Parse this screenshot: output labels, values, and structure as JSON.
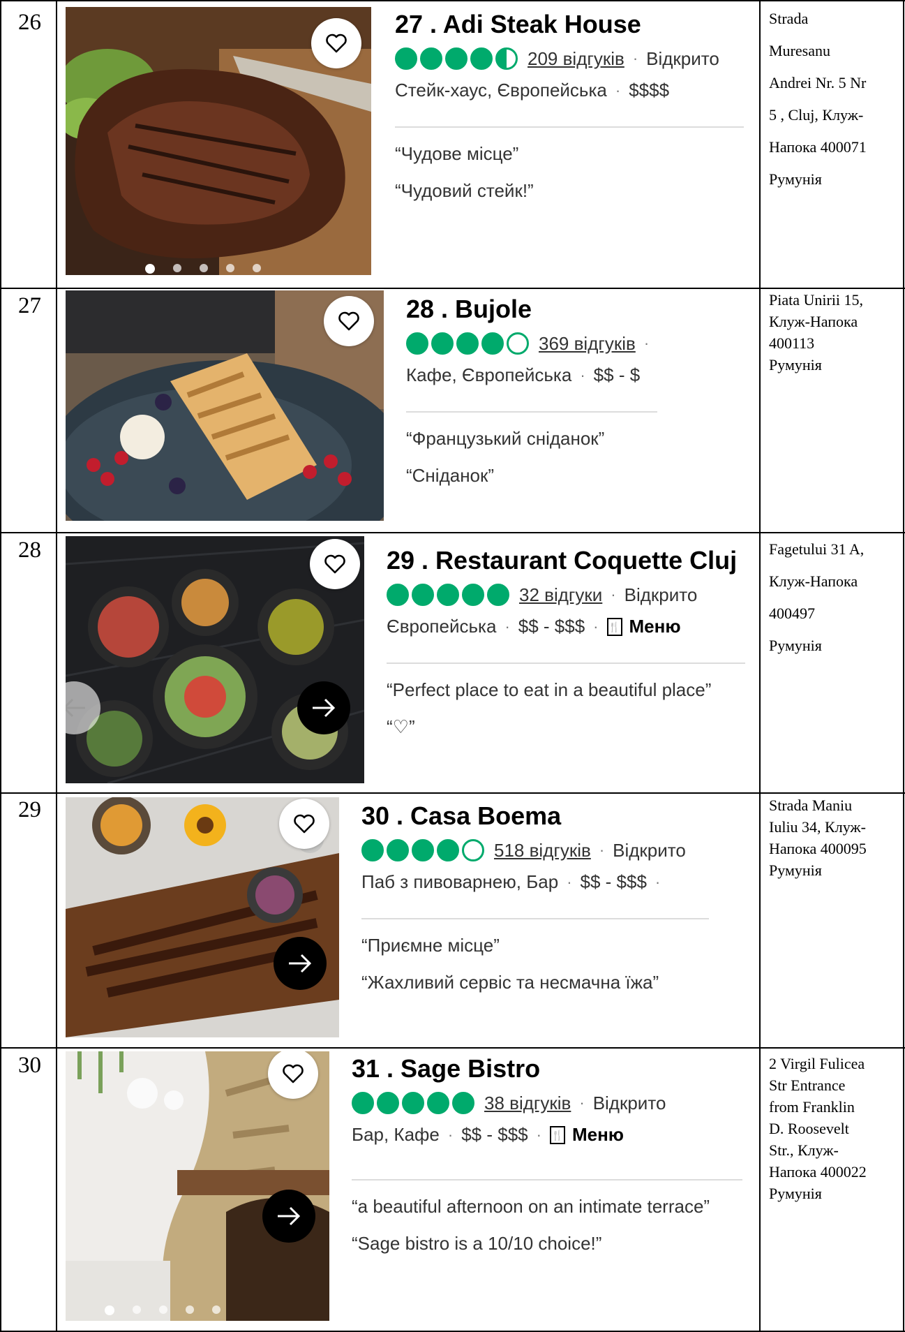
{
  "rows": [
    {
      "num": "26",
      "title": "27 . Adi Steak House",
      "rating": [
        1,
        1,
        1,
        1,
        0.5
      ],
      "reviews": "209 відгуків",
      "status": "Відкрито",
      "cuisine": "Стейк-хаус, Європейська",
      "price": "$$$$",
      "quotes": [
        "“Чудове місце”",
        "“Чудовий стейк!”"
      ],
      "address": [
        "Strada",
        "Muresanu",
        "Andrei Nr. 5 Nr",
        "5 , Cluj, Клуж-",
        "Напока 400071",
        "Румунія"
      ]
    },
    {
      "num": "27",
      "title": "28 . Bujole",
      "rating": [
        1,
        1,
        1,
        1,
        0
      ],
      "reviews": "369 відгуків",
      "status": "·",
      "cuisine": "Кафе, Європейська",
      "price": "$$ - $",
      "quotes": [
        "“Французький сніданок”",
        "“Сніданок”"
      ],
      "address": [
        "Piata Unirii 15,",
        "Клуж-Напока",
        "400113",
        "Румунія"
      ]
    },
    {
      "num": "28",
      "title": "29 . Restaurant Coquette Cluj",
      "rating": [
        1,
        1,
        1,
        1,
        1
      ],
      "reviews": "32 відгуки",
      "status": "Відкрито",
      "cuisine": "Європейська",
      "price": "$$ - $$$",
      "menu": "Меню",
      "quotes": [
        "“Perfect place to eat in a beautiful place”",
        "“♡”"
      ],
      "address": [
        "Fagetului 31 A,",
        "Клуж-Напока",
        "400497",
        "Румунія"
      ]
    },
    {
      "num": "29",
      "title": "30 . Casa Boema",
      "rating": [
        1,
        1,
        1,
        1,
        0
      ],
      "reviews": "518 відгуків",
      "status": "Відкрито",
      "cuisine": "Паб з пивоварнею, Бар",
      "price": "$$ - $$$",
      "quotes": [
        "“Приємне місце”",
        "“Жахливий сервіс та несмачна їжа”"
      ],
      "address": [
        "Strada Maniu",
        "Iuliu 34, Клуж-",
        "Напока 400095",
        "Румунія"
      ]
    },
    {
      "num": "30",
      "title": "31 . Sage Bistro",
      "rating": [
        1,
        1,
        1,
        1,
        1
      ],
      "reviews": "38 відгуків",
      "status": "Відкрито",
      "cuisine": "Бар, Кафе",
      "price": "$$ - $$$",
      "menu": "Меню",
      "quotes": [
        "“a beautiful afternoon on an intimate terrace”",
        "“Sage bistro is a 10/10 choice!”"
      ],
      "address": [
        "2 Virgil Fulicea",
        "Str Entrance",
        "from Franklin",
        "D. Roosevelt",
        "Str., Клуж-",
        "Напока 400022",
        "Румунія"
      ]
    }
  ],
  "colors": {
    "bubble": "#00aa6c",
    "border": "#000000"
  },
  "icons": [
    "heart-icon",
    "arrow-right-icon",
    "arrow-left-icon",
    "menu-icon"
  ]
}
